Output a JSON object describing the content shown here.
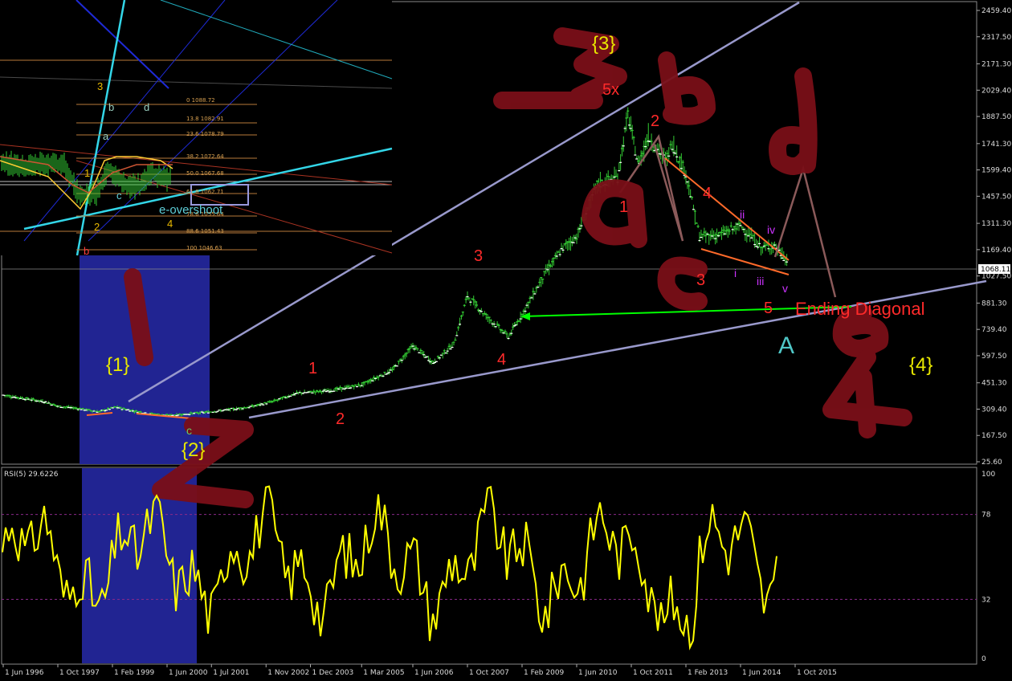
{
  "chart_data": {
    "type": "line",
    "subtype": "candlestick-with-annotations",
    "price_axis": {
      "ticks": [
        "2459.40",
        "2317.50",
        "2171.30",
        "2029.40",
        "1887.50",
        "1741.30",
        "1599.40",
        "1457.50",
        "1311.30",
        "1169.40",
        "1027.50",
        "881.30",
        "739.40",
        "597.50",
        "451.30",
        "309.40",
        "167.50",
        "25.60"
      ],
      "current_price": "1068.11"
    },
    "time_axis": {
      "ticks": [
        "1 Jun 1996",
        "1 Oct 1997",
        "1 Feb 1999",
        "1 Jun 2000",
        "1 Jul 2001",
        "1 Nov 2002",
        "1 Dec 2003",
        "1 Mar 2005",
        "1 Jun 2006",
        "1 Oct 2007",
        "1 Feb 2009",
        "1 Jun 2010",
        "1 Oct 2011",
        "1 Feb 2013",
        "1 Jun 2014",
        "1 Oct 2015"
      ]
    },
    "price_series": {
      "name": "price",
      "x": [
        "1996-06",
        "1997-06",
        "1997-10",
        "1998-03",
        "1998-10",
        "1999-03",
        "1999-08",
        "2000-01",
        "2000-06",
        "2001-01",
        "2001-07",
        "2002-06",
        "2003-01",
        "2003-08",
        "2004-06",
        "2005-03",
        "2005-12",
        "2006-06",
        "2006-12",
        "2007-06",
        "2007-10",
        "2008-03",
        "2008-10",
        "2009-02",
        "2009-09",
        "2010-02",
        "2010-06",
        "2010-12",
        "2011-06",
        "2011-09",
        "2011-12",
        "2012-03",
        "2012-08",
        "2012-10",
        "2013-02",
        "2013-06",
        "2013-12",
        "2014-06",
        "2014-12",
        "2015-04",
        "2015-08"
      ],
      "values": [
        385,
        350,
        325,
        315,
        295,
        320,
        300,
        285,
        275,
        285,
        295,
        320,
        350,
        395,
        410,
        440,
        520,
        650,
        560,
        660,
        920,
        820,
        700,
        820,
        1050,
        1180,
        1240,
        1520,
        1560,
        1900,
        1630,
        1780,
        1650,
        1740,
        1580,
        1240,
        1250,
        1300,
        1180,
        1190,
        1100
      ]
    },
    "rsi": {
      "title": "RSI(5) 29.6226",
      "levels": [
        78,
        32
      ],
      "axis_ticks": [
        "100",
        "78",
        "32",
        "0"
      ]
    },
    "inset": {
      "fib_levels": [
        "0 1088.72",
        "13.8 1082.91",
        "23.6 1078.79",
        "38.2 1072.64",
        "50.0 1067.68",
        "61.8 1062.71",
        "78.6 1055.64",
        "88.6 1051.43",
        "100 1046.63"
      ],
      "labels": {
        "three": "3",
        "b_top": "b",
        "d": "d",
        "a": "a",
        "one": "1",
        "c": "c",
        "two": "2",
        "four": "4",
        "b_bottom": "b",
        "e_overshoot": "e-overshoot"
      }
    },
    "wave_labels": {
      "w1_braced": "{1}",
      "w2_braced": "{2}",
      "w3_braced": "{3}",
      "w4_braced": "{4}",
      "wave1": "1",
      "wave2": "2",
      "wave3": "3",
      "wave4": "4",
      "five_x": "5x",
      "post_two": "2",
      "post_four": "4",
      "post_three": "3",
      "post_five": "5",
      "sub_i": "i",
      "sub_ii": "ii",
      "sub_iii": "iii",
      "sub_iv": "iv",
      "sub_v": "v",
      "ending_diagonal": "Ending Diagonal",
      "big_A": "A",
      "c_small": "c",
      "one_near_a": "1"
    },
    "handwritten_labels": [
      "3",
      "b",
      "d",
      "a",
      "c",
      "e",
      "1",
      "2",
      "4"
    ]
  }
}
